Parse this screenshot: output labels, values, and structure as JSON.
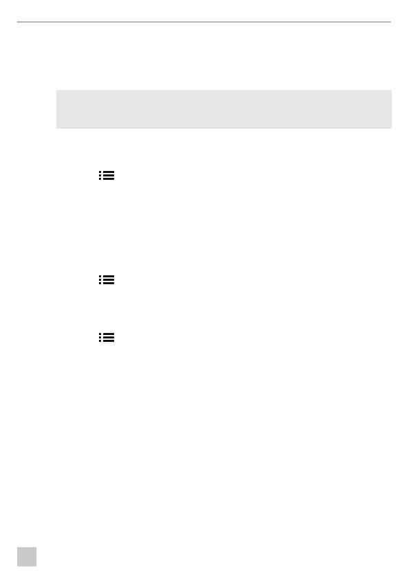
{
  "document": {
    "header_rule": true,
    "gray_panel": true,
    "list_icons": [
      {
        "name": "list-icon"
      },
      {
        "name": "list-icon"
      },
      {
        "name": "list-icon"
      }
    ],
    "page_tab_color": "#c9c9c9",
    "panel_color": "#e6e6e6"
  }
}
